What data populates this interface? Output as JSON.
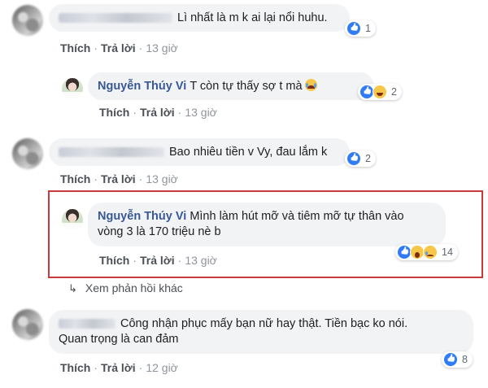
{
  "comments": [
    {
      "text": "Lì nhất là m k ai lại nổi huhu.",
      "reaction_count": "1",
      "actions": {
        "like": "Thích",
        "reply": "Trả lời",
        "time": "13 giờ"
      }
    },
    {
      "author": "Nguyễn Thúy Vi",
      "text": "T còn tự thấy sợ t mà",
      "reaction_count": "2",
      "actions": {
        "like": "Thích",
        "reply": "Trả lời",
        "time": "13 giờ"
      }
    },
    {
      "text": "Bao nhiêu tiền v Vy, đau lắm k",
      "reaction_count": "2",
      "actions": {
        "like": "Thích",
        "reply": "Trả lời",
        "time": "13 giờ"
      }
    },
    {
      "author": "Nguyễn Thúy Vi",
      "text_line1": "Mình làm hút mỡ và tiêm mỡ tự thân vào",
      "text_line2": "vòng 3 là 170 triệu nè b",
      "reaction_count": "14",
      "actions": {
        "like": "Thích",
        "reply": "Trả lời",
        "time": "13 giờ"
      }
    },
    {
      "text_line1": "Công nhận phục mấy bạn nữ hay thật. Tiền bạc ko nói.",
      "text_line2": "Quan trọng là can đảm",
      "reaction_count": "8",
      "actions": {
        "like": "Thích",
        "reply": "Trả lời",
        "time": "12 giờ"
      }
    }
  ],
  "more_replies": {
    "arrow": "↳",
    "label": "Xem phản hồi khác"
  },
  "icons": {
    "reply_arrow": "reply-arrow-icon"
  },
  "colors": {
    "author": "#385898",
    "bubble": "#f2f3f5",
    "highlight": "#c93a3a",
    "like": "#2f7cf6"
  }
}
